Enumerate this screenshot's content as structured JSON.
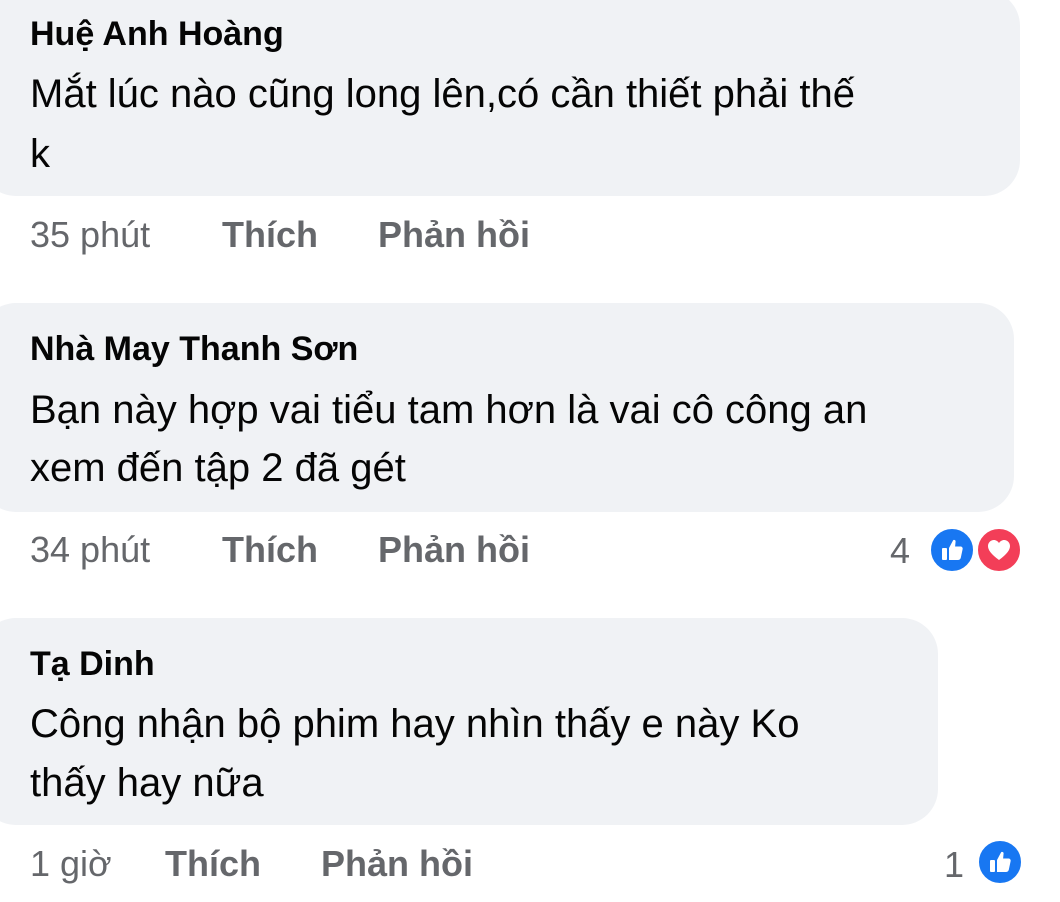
{
  "comments": [
    {
      "author": "Huệ Anh Hoàng",
      "lines": [
        "Mắt lúc nào cũng long lên,có cần thiết phải thế",
        "k"
      ],
      "time": "35 phút",
      "like_label": "Thích",
      "reply_label": "Phản hồi"
    },
    {
      "author": "Nhà May Thanh Sơn",
      "lines": [
        "Bạn này hợp vai tiểu tam hơn là vai cô công an",
        "xem đến tập 2 đã gét"
      ],
      "time": "34 phút",
      "like_label": "Thích",
      "reply_label": "Phản hồi",
      "reaction_count": "4",
      "reactions": [
        "like-icon",
        "love-icon"
      ]
    },
    {
      "author": "Tạ Dinh",
      "lines": [
        "Công nhận bộ phim hay nhìn thấy e này Ko",
        "thấy hay nữa"
      ],
      "time": "1 giờ",
      "like_label": "Thích",
      "reply_label": "Phản hồi",
      "reaction_count": "1",
      "reactions": [
        "like-icon"
      ]
    }
  ],
  "colors": {
    "bubble": "#f0f2f5",
    "text": "#050505",
    "secondary": "#65676b",
    "like": "#1877f2",
    "love": "#f33e58"
  }
}
